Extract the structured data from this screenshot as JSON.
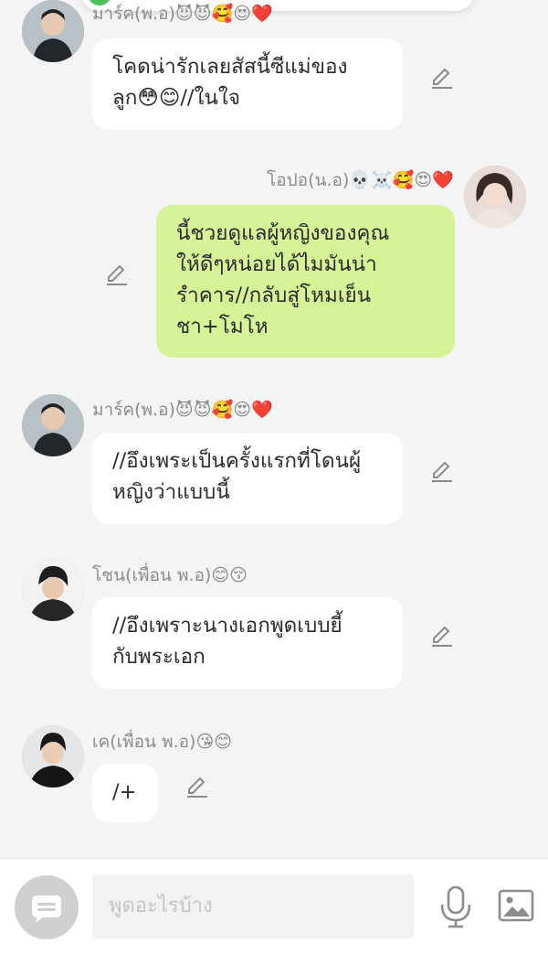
{
  "messages": [
    {
      "sender": "มาร์ค(พ.อ)",
      "emojis": "😈😈🥰😍❤️",
      "text": "โคดน่ารักเลยสัสนี้ซีแม่ของ\nลูก😳😊//ในใจ"
    },
    {
      "sender": "โอปอ(น.อ)",
      "emojis": "💀☠️🥰😍❤️",
      "text": "นี้ชวยดูแลผู้หญิงของคุณ\nให้ดีๆหน่อยได้ไมมันน่า\nรำคาร//กลับสู่โหมเย็น\nชา+โมโห"
    },
    {
      "sender": "มาร์ค(พ.อ)",
      "emojis": "😈😈🥰😍❤️",
      "text": "//อึงเพระเป็นครั้งแรกที่โดนผู้\nหญิงว่าแบบนี้"
    },
    {
      "sender": "โชน(เพื่อน พ.อ)",
      "emojis": "😊😚",
      "text": "//อึงเพราะนางเอกพูดเบบยี้\nกับพระเอก"
    },
    {
      "sender": "เค(เพื่อน พ.อ)",
      "emojis": "😘😊",
      "text": "/+"
    }
  ],
  "input": {
    "placeholder": "พูดอะไรบ้าง"
  },
  "colors": {
    "background": "#f4f4f4",
    "left_bubble": "#ffffff",
    "right_bubble": "#d6f398",
    "icon": "#8c8c8c"
  }
}
